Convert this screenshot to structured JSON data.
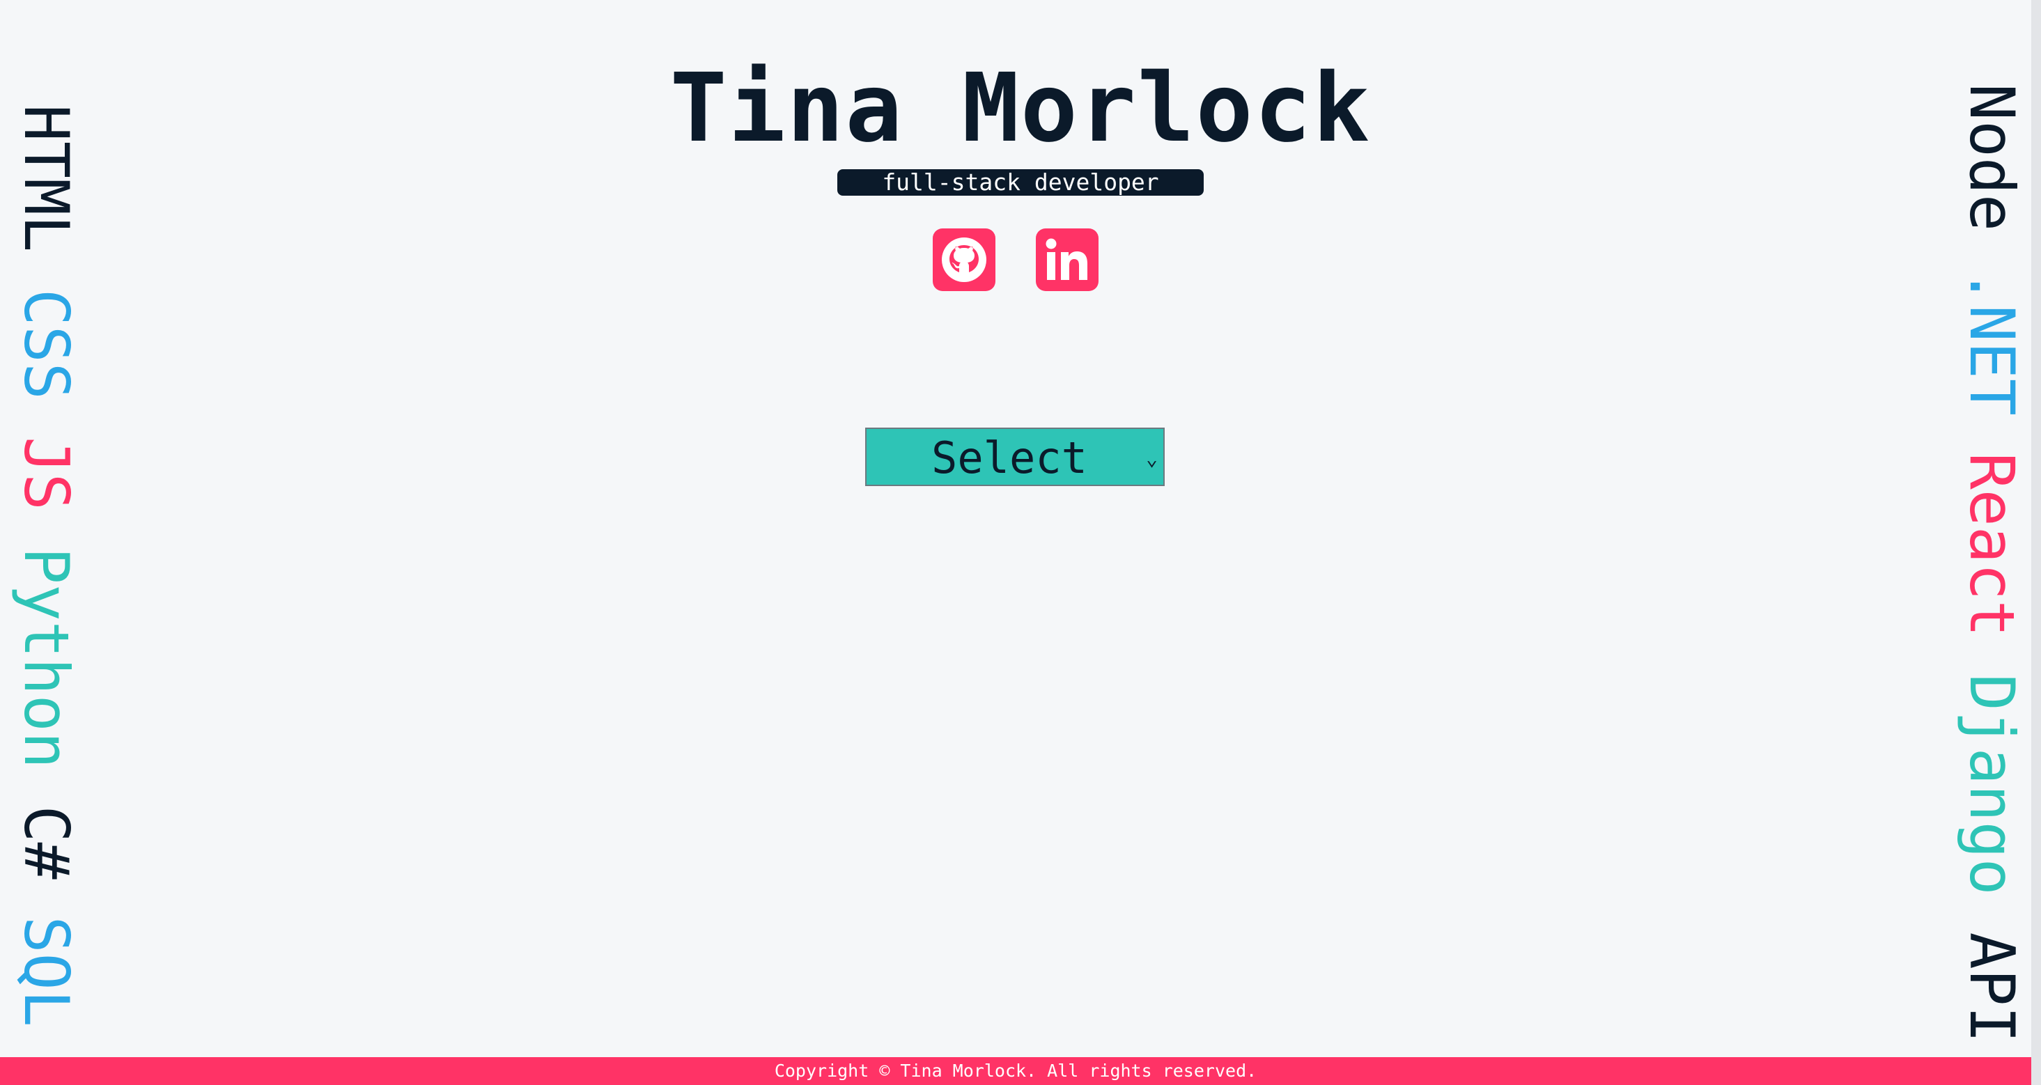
{
  "header": {
    "name": "Tina Morlock",
    "tagline": "full-stack developer"
  },
  "social": {
    "github_icon": "github-icon",
    "linkedin_icon": "linkedin-icon",
    "color": "#ff3366"
  },
  "left_skills": [
    {
      "label": "HTML",
      "color": "#0b1a2a"
    },
    {
      "label": "CSS",
      "color": "#2aa6e6"
    },
    {
      "label": "JS",
      "color": "#ff3366"
    },
    {
      "label": "Python",
      "color": "#2ec4b6"
    },
    {
      "label": "C#",
      "color": "#0b1a2a"
    },
    {
      "label": "SQL",
      "color": "#2aa6e6"
    }
  ],
  "right_skills": [
    {
      "label": "Node",
      "color": "#0b1a2a"
    },
    {
      "label": ".NET",
      "color": "#2aa6e6"
    },
    {
      "label": "React",
      "color": "#ff3366"
    },
    {
      "label": "Django",
      "color": "#2ec4b6"
    },
    {
      "label": "API",
      "color": "#0b1a2a"
    }
  ],
  "select": {
    "selected": "Select",
    "background": "#2ec4b6"
  },
  "footer": {
    "text": "Copyright © Tina Morlock. All rights reserved.",
    "background": "#ff3366"
  }
}
